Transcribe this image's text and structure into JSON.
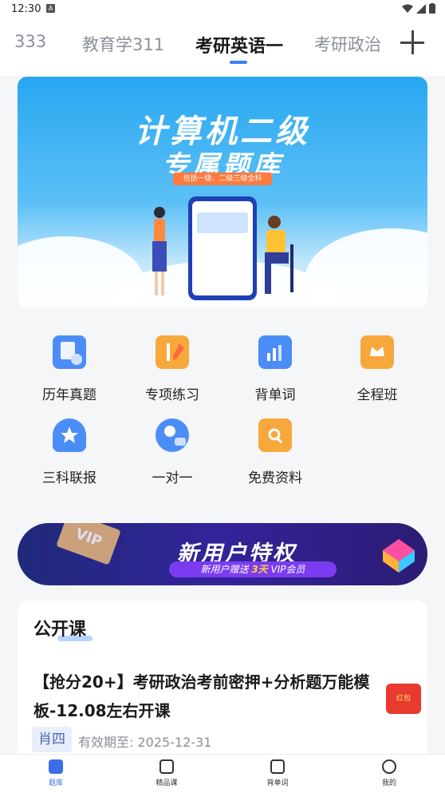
{
  "status_bar": {
    "time": "12:30",
    "notification_icon": "A"
  },
  "tabs": [
    {
      "label": "333"
    },
    {
      "label": "教育学311"
    },
    {
      "label": "考研英语一",
      "active": true
    },
    {
      "label": "考研政治"
    }
  ],
  "banner": {
    "title_line1": "计算机二级",
    "title_line2": "专属题库",
    "tag": "包括一级、二级三级全科"
  },
  "features": [
    {
      "label": "历年真题",
      "icon": "calendar-icon",
      "color": "#4a8df7"
    },
    {
      "label": "专项练习",
      "icon": "pencil-book-icon",
      "color": "#f7a83a"
    },
    {
      "label": "背单词",
      "icon": "chart-card-icon",
      "color": "#4a8df7"
    },
    {
      "label": "全程班",
      "icon": "crown-icon",
      "color": "#f7a83a"
    },
    {
      "label": "三科联报",
      "icon": "trophy-star-icon",
      "color": "#4a8df7"
    },
    {
      "label": "一对一",
      "icon": "chat-person-icon",
      "color": "#4a8df7"
    },
    {
      "label": "免费资料",
      "icon": "search-doc-icon",
      "color": "#f7a83a"
    }
  ],
  "promo": {
    "title": "新用户特权",
    "sub_prefix": "新用户赠送 ",
    "sub_highlight": "3天",
    "sub_suffix": " VIP会员",
    "vip": "VIP"
  },
  "open_class": {
    "section_title": "公开课",
    "course_title": "【抢分20+】考研政治考前密押+分析题万能模板-12.08左右开课",
    "teacher": "肖四",
    "valid_label": "有效期至:",
    "valid_date": "2025-12-31",
    "redpack": "红包"
  },
  "bottom_nav": [
    {
      "label": "题库",
      "active": true
    },
    {
      "label": "精品课"
    },
    {
      "label": "背单词"
    },
    {
      "label": "我的"
    }
  ]
}
